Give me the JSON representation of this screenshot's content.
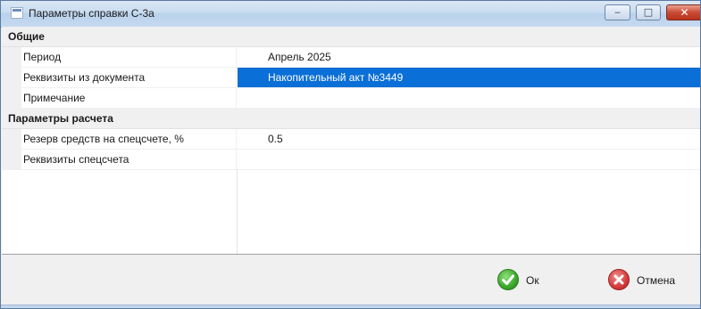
{
  "window": {
    "title": "Параметры справки С-3а",
    "controls": {
      "minimize": "‒",
      "maximize": "□",
      "close": "✕"
    }
  },
  "grid": {
    "categories": [
      {
        "label": "Общие",
        "properties": [
          {
            "name": "Период",
            "value": "Апрель 2025",
            "selected": false
          },
          {
            "name": "Реквизиты из документа",
            "value": "Накопительный акт №3449",
            "selected": true
          },
          {
            "name": "Примечание",
            "value": "",
            "selected": false
          }
        ]
      },
      {
        "label": "Параметры расчета",
        "properties": [
          {
            "name": "Резерв средств на спецсчете, %",
            "value": "0.5",
            "selected": false
          },
          {
            "name": "Реквизиты спецсчета",
            "value": "",
            "selected": false
          }
        ]
      }
    ]
  },
  "footer": {
    "ok_label": "Ок",
    "cancel_label": "Отмена",
    "ok_icon": "check-circle-icon",
    "cancel_icon": "cross-circle-icon"
  },
  "colors": {
    "selection": "#0a6fd6",
    "ok_green": "#3aa72a",
    "cancel_red": "#d63a3a"
  }
}
